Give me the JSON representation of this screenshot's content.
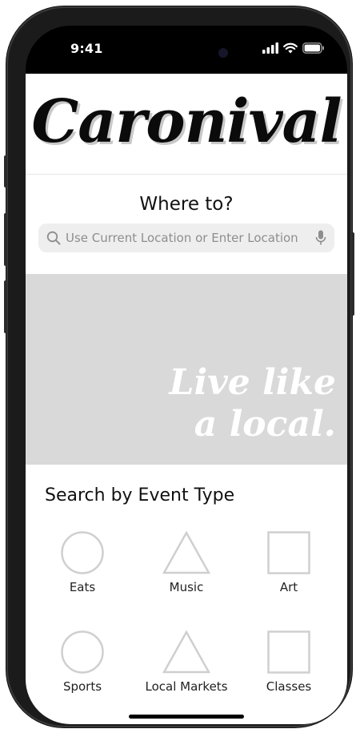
{
  "status_bar": {
    "time": "9:41",
    "icons": [
      "cellular-signal-icon",
      "wifi-icon",
      "battery-icon"
    ]
  },
  "app": {
    "logo": "Caronival"
  },
  "location": {
    "title": "Where to?",
    "search_placeholder": "Use Current Location or Enter Location",
    "search_icon": "search-icon",
    "mic_icon": "microphone-icon"
  },
  "hero": {
    "tagline_line1": "Live like",
    "tagline_line2": "a local."
  },
  "events": {
    "title": "Search by Event Type",
    "items": [
      {
        "label": "Eats",
        "shape": "circle"
      },
      {
        "label": "Music",
        "shape": "triangle"
      },
      {
        "label": "Art",
        "shape": "square"
      },
      {
        "label": "Sports",
        "shape": "circle"
      },
      {
        "label": "Local Markets",
        "shape": "triangle"
      },
      {
        "label": "Classes",
        "shape": "square"
      }
    ]
  },
  "colors": {
    "hero_background": "#d9d9d9",
    "search_background": "#eeeeee",
    "shape_stroke": "#cfcfcf"
  }
}
